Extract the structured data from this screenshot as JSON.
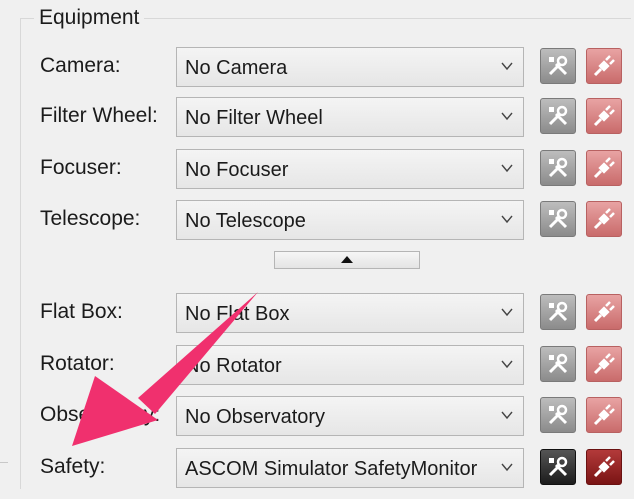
{
  "group": {
    "title": "Equipment"
  },
  "rows": [
    {
      "label": "Camera:",
      "value": "No Camera"
    },
    {
      "label": "Filter Wheel:",
      "value": "No Filter Wheel"
    },
    {
      "label": "Focuser:",
      "value": "No Focuser"
    },
    {
      "label": "Telescope:",
      "value": "No Telescope"
    },
    {
      "label": "Flat Box:",
      "value": "No Flat Box"
    },
    {
      "label": "Rotator:",
      "value": "No Rotator"
    },
    {
      "label": "Observatory:",
      "value": "No Observatory"
    },
    {
      "label": "Safety:",
      "value": "ASCOM Simulator SafetyMonitor"
    }
  ],
  "icons": {
    "setup": "wrench-screwdriver-icon",
    "connect": "plug-icon",
    "expander": "collapse-up-icon",
    "dropdown": "chevron-down-icon"
  },
  "colors": {
    "annotation_arrow": "#f0306e",
    "connect_button": "#d07777",
    "setup_button": "#9e9e9e"
  }
}
